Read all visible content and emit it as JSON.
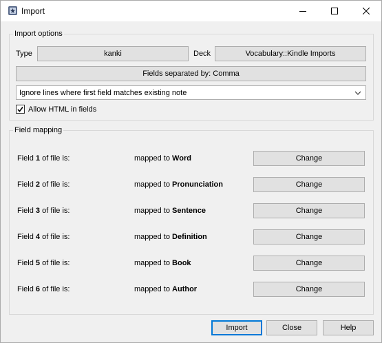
{
  "window": {
    "title": "Import"
  },
  "import_options": {
    "group_title": "Import options",
    "type_label": "Type",
    "type_value": "kanki",
    "deck_label": "Deck",
    "deck_value": "Vocabulary::Kindle Imports",
    "separator_button": "Fields separated by: Comma",
    "duplicate_mode": "Ignore lines where first field matches existing note",
    "allow_html_label": "Allow HTML in fields",
    "allow_html_checked": true
  },
  "field_mapping": {
    "group_title": "Field mapping",
    "field_prefix": "Field",
    "field_suffix": "of file is:",
    "mapped_prefix": "mapped to",
    "change_label": "Change",
    "rows": [
      {
        "num": "1",
        "target": "Word"
      },
      {
        "num": "2",
        "target": "Pronunciation"
      },
      {
        "num": "3",
        "target": "Sentence"
      },
      {
        "num": "4",
        "target": "Definition"
      },
      {
        "num": "5",
        "target": "Book"
      },
      {
        "num": "6",
        "target": "Author"
      }
    ]
  },
  "footer": {
    "import_label": "Import",
    "close_label": "Close",
    "help_label": "Help"
  }
}
